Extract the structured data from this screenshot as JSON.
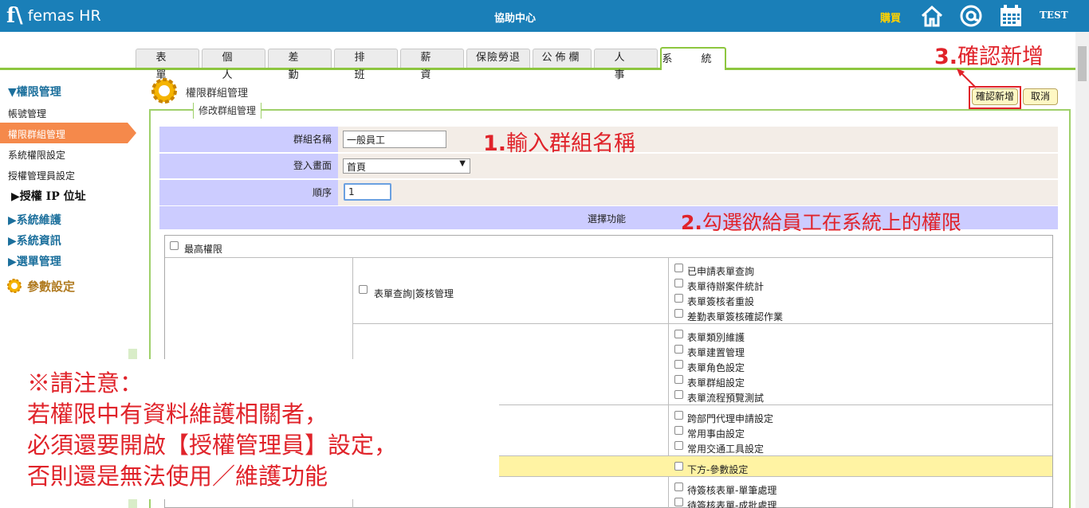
{
  "header": {
    "logo_text": "femas HR",
    "center_title": "協助中心",
    "buy_label": "購買",
    "user_name": "TEST"
  },
  "tabs": [
    "表 單",
    "個 人",
    "差 勤",
    "排 班",
    "薪 資",
    "保險勞退",
    "公佈欄",
    "人 事",
    "系 統"
  ],
  "sidebar": {
    "section_title": "▼權限管理",
    "items": [
      "帳號管理",
      "權限群組管理",
      "系統權限設定",
      "授權管理員設定"
    ],
    "sub_heading": "▶授權 IP 位址",
    "heads": [
      "▶系統維護",
      "▶系統資訊",
      "▶選單管理"
    ],
    "params_label": "參數設定"
  },
  "main": {
    "page_title": "權限群組管理",
    "legend": "修改群組管理",
    "confirm_label": "確認新增",
    "cancel_label": "取消",
    "group_name_label": "群組名稱",
    "group_name_value": "一般員工",
    "login_screen_label": "登入畫面",
    "login_screen_value": "首頁",
    "order_label": "順序",
    "order_value": "1",
    "select_function_label": "選擇功能",
    "top_permission": "最高權限",
    "form_query_label": "表單查詢|簽核管理",
    "group1": [
      "已申請表單查詢",
      "表單待辦案件統計",
      "表單簽核者重設",
      "差勤表單簽核確認作業"
    ],
    "group2": [
      "表單類別維護",
      "表單建置管理",
      "表單角色設定",
      "表單群組設定",
      "表單流程預覽測試"
    ],
    "group3": [
      "跨部門代理申請設定",
      "常用事由設定",
      "常用交通工具設定"
    ],
    "group4": [
      "下方-參數設定"
    ],
    "group5": [
      "待簽核表單-單筆處理",
      "待簽核表單-成批處理"
    ]
  },
  "annotations": {
    "step1_num": "1.",
    "step1_text": "輸入群組名稱",
    "step2_num": "2.",
    "step2_text": "勾選欲給員工在系統上的權限",
    "step3_num": "3.",
    "step3_text": "確認新增",
    "note_lines": [
      "※請注意：",
      "若權限中有資料維護相關者，",
      "必須還要開啟【授權管理員】設定，",
      "否則還是無法使用／維護功能"
    ]
  },
  "colors": {
    "header_blue": "#1a7fb8",
    "tab_green": "#8dc63f",
    "sidebar_active": "#f5894b",
    "annotation_red": "#e0232a",
    "label_bg": "#ccccff"
  }
}
